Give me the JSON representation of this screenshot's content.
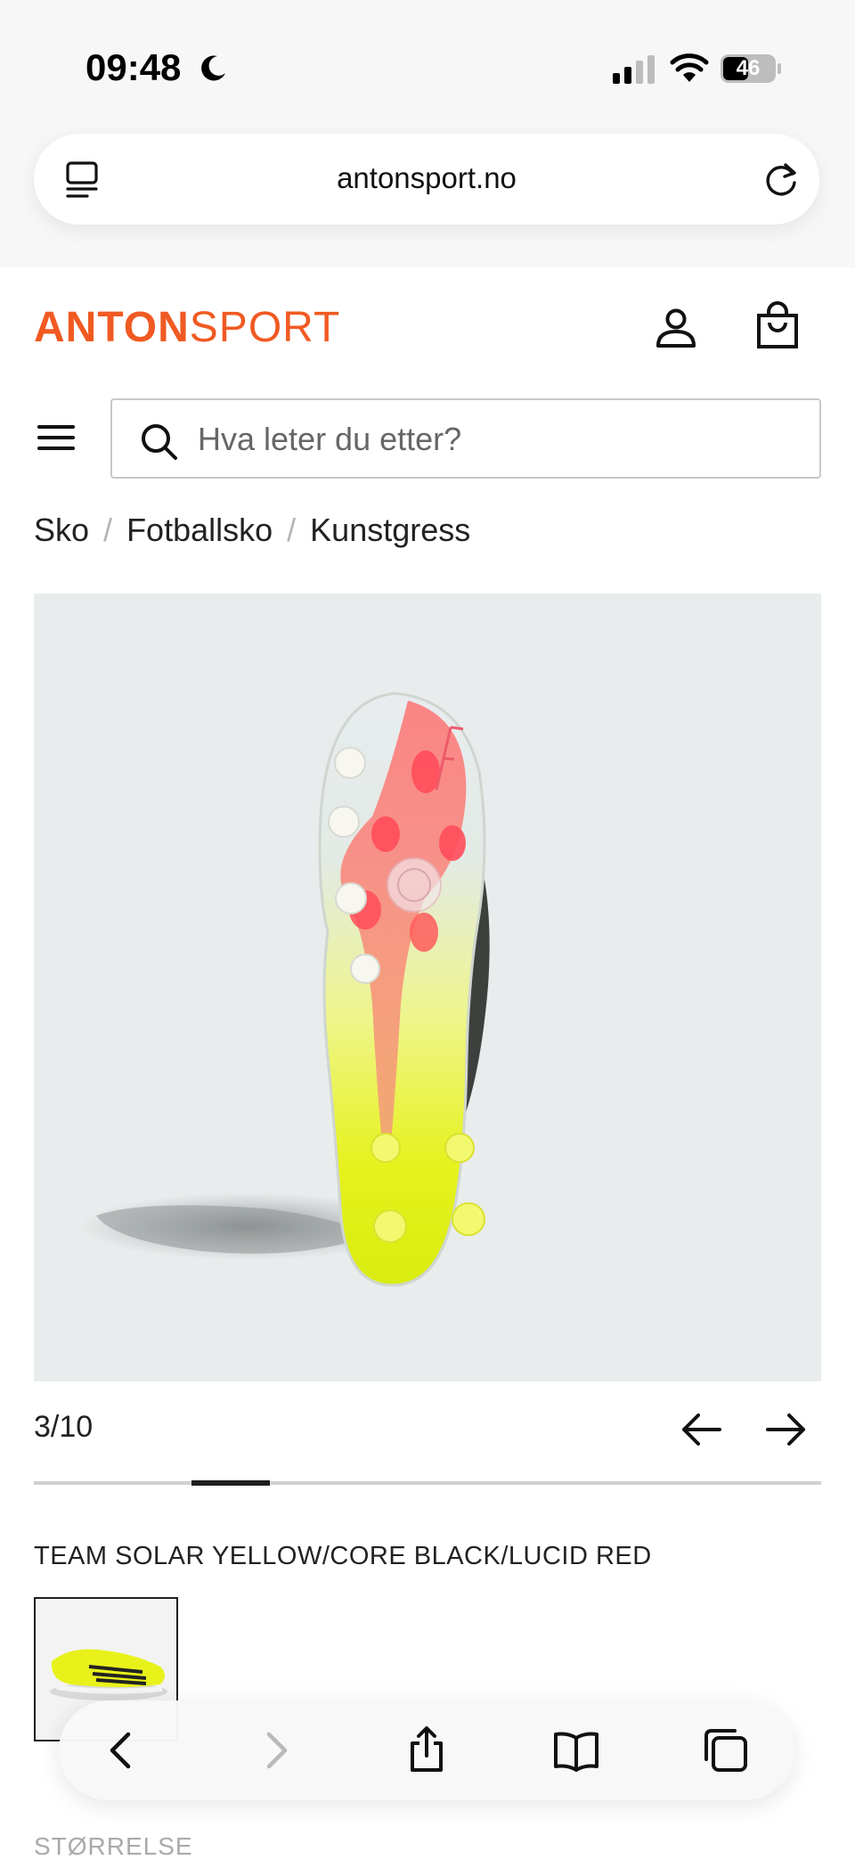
{
  "status_bar": {
    "time": "09:48",
    "battery_level": "46",
    "icons": [
      "moon-icon",
      "cellular-signal-icon",
      "wifi-icon",
      "battery-icon"
    ]
  },
  "browser": {
    "url": "antonsport.no",
    "icons": [
      "reader-mode-icon",
      "reload-icon"
    ]
  },
  "header": {
    "logo_bold": "ANTON",
    "logo_light": "SPORT",
    "brand_color": "#f05a22",
    "icons": [
      "account-icon",
      "shopping-bag-icon",
      "hamburger-menu-icon"
    ]
  },
  "search": {
    "placeholder": "Hva leter du etter?"
  },
  "breadcrumb": {
    "items": [
      "Sko",
      "Fotballsko",
      "Kunstgress"
    ],
    "separator": "/"
  },
  "gallery": {
    "counter": "3/10",
    "current": 3,
    "total": 10,
    "icons": [
      "arrow-left-icon",
      "arrow-right-icon"
    ]
  },
  "product": {
    "color_name": "TEAM SOLAR YELLOW/CORE BLACK/LUCID RED",
    "size_label": "STØRRELSE"
  },
  "toolbar": {
    "icons": [
      "back-icon",
      "forward-icon",
      "share-icon",
      "bookmarks-icon",
      "tabs-icon"
    ]
  }
}
